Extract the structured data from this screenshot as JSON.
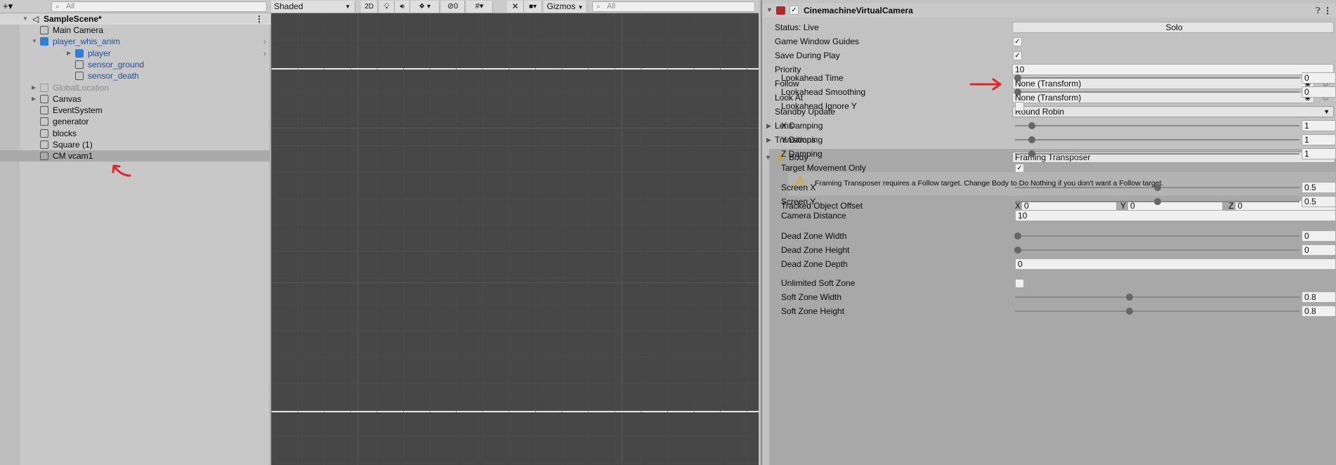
{
  "hierarchy": {
    "add_label": "+▾",
    "search_placeholder": "All",
    "scene_name": "SampleScene*",
    "items": [
      {
        "name": "Main Camera",
        "depth": 1,
        "expand": "",
        "kind": "go",
        "selected": false
      },
      {
        "name": "player_whis_anim",
        "depth": 1,
        "expand": "open",
        "kind": "prefab",
        "selected": false,
        "more": true
      },
      {
        "name": "player",
        "depth": 2,
        "expand": "closed",
        "kind": "prefab",
        "selected": false,
        "more": true
      },
      {
        "name": "sensor_ground",
        "depth": 2,
        "expand": "",
        "kind": "prefab-child",
        "selected": false
      },
      {
        "name": "sensor_death",
        "depth": 2,
        "expand": "",
        "kind": "prefab-child",
        "selected": false
      },
      {
        "name": "GlobalLocation",
        "depth": 1,
        "expand": "closed",
        "kind": "inactive",
        "selected": false
      },
      {
        "name": "Canvas",
        "depth": 1,
        "expand": "closed",
        "kind": "go",
        "selected": false
      },
      {
        "name": "EventSystem",
        "depth": 1,
        "expand": "",
        "kind": "go",
        "selected": false
      },
      {
        "name": "generator",
        "depth": 1,
        "expand": "",
        "kind": "go",
        "selected": false
      },
      {
        "name": "blocks",
        "depth": 1,
        "expand": "",
        "kind": "go",
        "selected": false
      },
      {
        "name": "Square (1)",
        "depth": 1,
        "expand": "",
        "kind": "go",
        "selected": false
      },
      {
        "name": "CM vcam1",
        "depth": 1,
        "expand": "",
        "kind": "go",
        "selected": true
      }
    ]
  },
  "scene_toolbar": {
    "shading": "Shaded",
    "mode_2d": "2D",
    "hidden_count": "0",
    "gizmos": "Gizmos",
    "search_placeholder": "All"
  },
  "inspector": {
    "component_title": "CinemachineVirtualCamera",
    "component_enabled": true,
    "status": "Status: Live",
    "solo": "Solo",
    "rows": [
      {
        "label": "Game Window Guides",
        "type": "check",
        "checked": true
      },
      {
        "label": "Save During Play",
        "type": "check",
        "checked": true
      },
      {
        "label": "Priority",
        "type": "text",
        "value": "10"
      },
      {
        "label": "Follow",
        "type": "object",
        "value": "None (Transform)"
      },
      {
        "label": "Look At",
        "type": "object",
        "value": "None (Transform)"
      },
      {
        "label": "Standby Update",
        "type": "dropdown",
        "value": "Round Robin"
      },
      {
        "label": "Lens",
        "type": "foldout"
      },
      {
        "label": "Transitions",
        "type": "foldout"
      }
    ],
    "body": {
      "label": "Body",
      "value": "Framing Transposer",
      "warning": "Framing Transposer requires a Follow target.  Change Body to Do Nothing if you don't want a Follow target.",
      "tracked_offset": {
        "label": "Tracked Object Offset",
        "x": "0",
        "y": "0",
        "z": "0",
        "x_label": "X",
        "y_label": "Y",
        "z_label": "Z"
      },
      "rows": [
        {
          "label": "Lookahead Time",
          "type": "slider",
          "value": "0",
          "min": 0,
          "max": 1
        },
        {
          "label": "Lookahead Smoothing",
          "type": "slider",
          "value": "0",
          "min": 0,
          "max": 30
        },
        {
          "label": "Lookahead Ignore Y",
          "type": "check",
          "checked": false
        },
        {
          "label": "X Damping",
          "type": "slider",
          "value": "1",
          "min": 0,
          "max": 20
        },
        {
          "label": "Y Damping",
          "type": "slider",
          "value": "1",
          "min": 0,
          "max": 20
        },
        {
          "label": "Z Damping",
          "type": "slider",
          "value": "1",
          "min": 0,
          "max": 20
        },
        {
          "label": "Target Movement Only",
          "type": "check",
          "checked": true
        },
        {
          "label": "Screen X",
          "type": "slider",
          "value": "0.5",
          "min": -0.5,
          "max": 1.5
        },
        {
          "label": "Screen Y",
          "type": "slider",
          "value": "0.5",
          "min": -0.5,
          "max": 1.5
        },
        {
          "label": "Camera Distance",
          "type": "text",
          "value": "10"
        },
        {
          "label": "Dead Zone Width",
          "type": "slider",
          "value": "0",
          "min": 0,
          "max": 2
        },
        {
          "label": "Dead Zone Height",
          "type": "slider",
          "value": "0",
          "min": 0,
          "max": 2
        },
        {
          "label": "Dead Zone Depth",
          "type": "text",
          "value": "0"
        },
        {
          "label": "Unlimited Soft Zone",
          "type": "check",
          "checked": false
        },
        {
          "label": "Soft Zone Width",
          "type": "slider",
          "value": "0.8",
          "min": 0,
          "max": 2
        },
        {
          "label": "Soft Zone Height",
          "type": "slider",
          "value": "0.8",
          "min": 0,
          "max": 2
        }
      ]
    }
  },
  "colors": {
    "annotation_arrow": "#e0252b",
    "prefab_text": "#1c4f9c",
    "scene_bg": "#474747"
  }
}
